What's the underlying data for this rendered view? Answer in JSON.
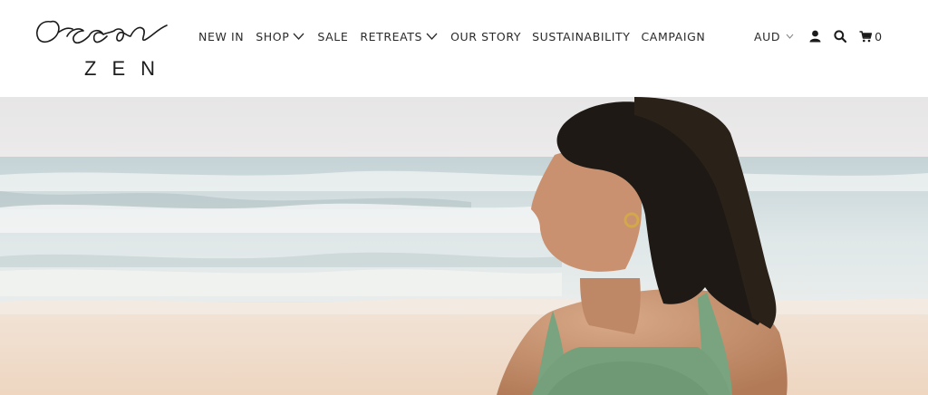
{
  "brand": {
    "script_name": "Ocean",
    "subtitle": "ZEN"
  },
  "nav": {
    "items": [
      {
        "label": "NEW IN",
        "dropdown": false
      },
      {
        "label": "SHOP",
        "dropdown": true
      },
      {
        "label": "SALE",
        "dropdown": false
      },
      {
        "label": "RETREATS",
        "dropdown": true
      },
      {
        "label": "OUR STORY",
        "dropdown": false
      },
      {
        "label": "SUSTAINABILITY",
        "dropdown": false
      },
      {
        "label": "CAMPAIGN",
        "dropdown": false
      }
    ]
  },
  "utilities": {
    "currency": "AUD",
    "cart_count": "0",
    "icons": [
      "user-icon",
      "search-icon",
      "cart-icon"
    ]
  },
  "hero": {
    "image_subject": "woman-in-green-swimsuit-at-beach"
  },
  "colors": {
    "text": "#2a2a2a",
    "sky": "#e9e8e8",
    "sea": "#cfdcdf",
    "sand": "#f0dccb",
    "swimsuit": "#7aa37f",
    "skin": "#c99775",
    "hair": "#1e1915"
  }
}
